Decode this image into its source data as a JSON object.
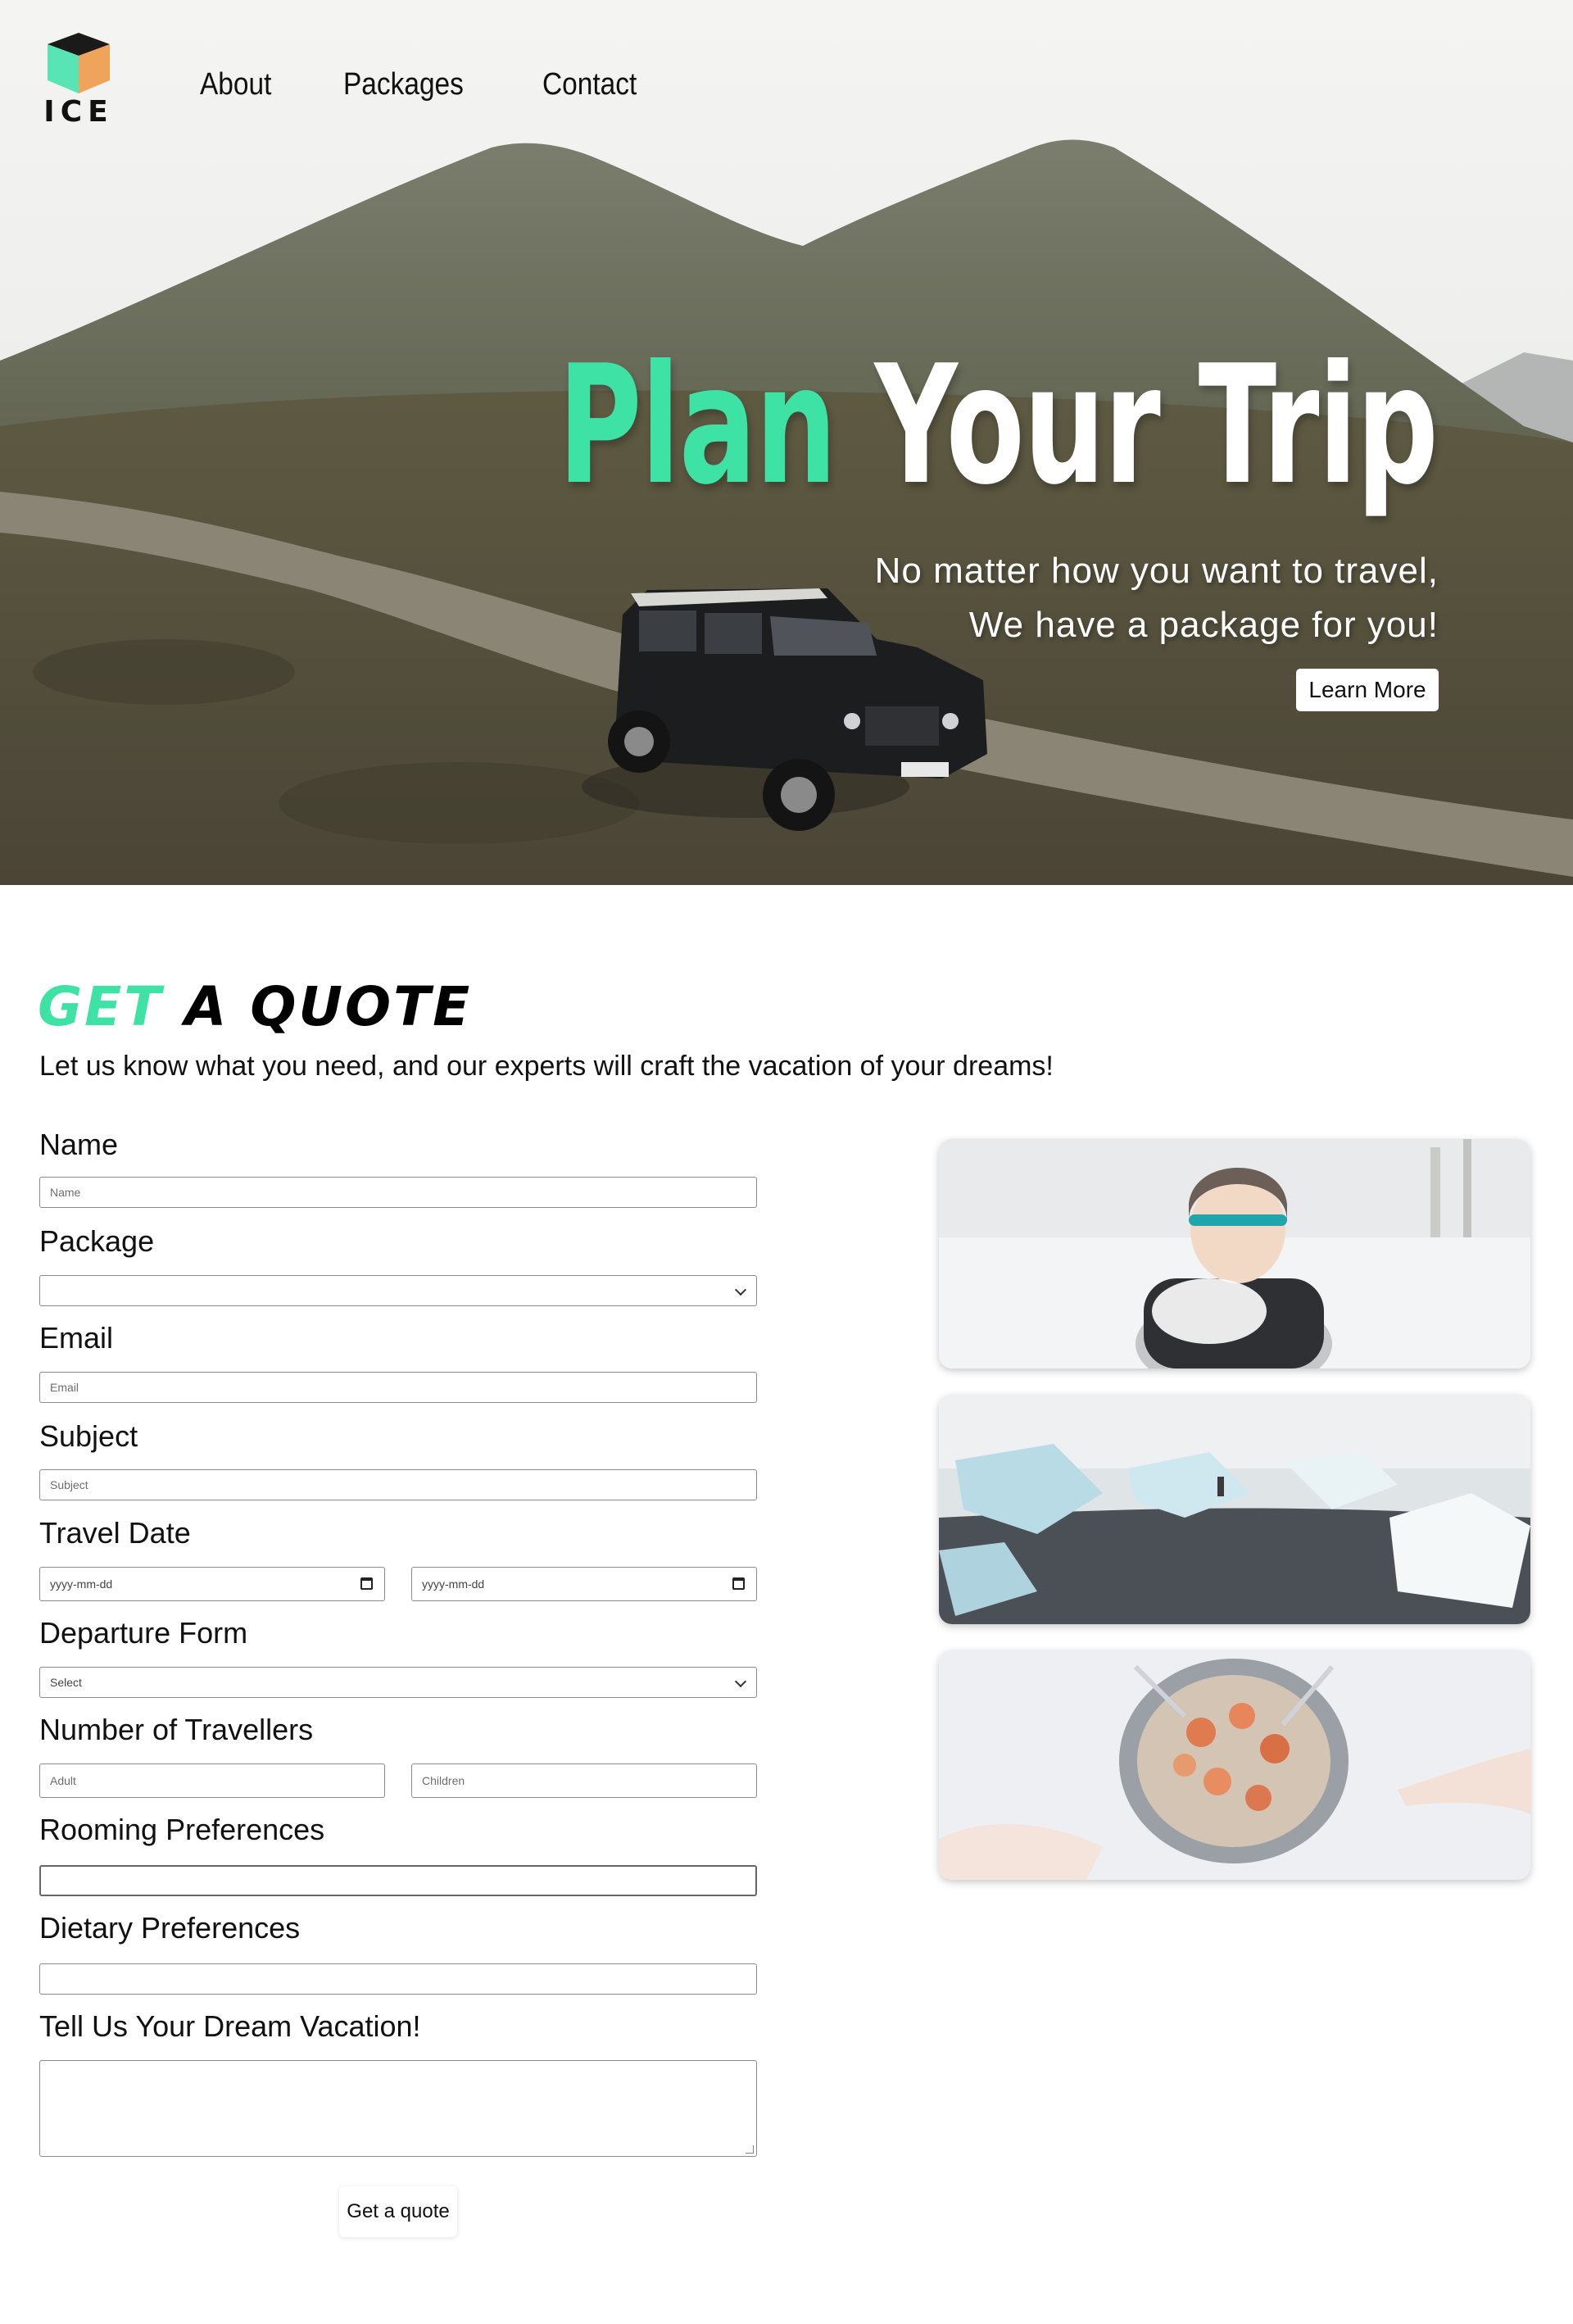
{
  "brand": {
    "logo_text": "ICE"
  },
  "nav": {
    "items": [
      "About",
      "Packages",
      "Contact"
    ]
  },
  "hero": {
    "title_accent": "Plan",
    "title_rest": "Your Trip",
    "subtitle_line1": "No matter how you want to travel,",
    "subtitle_line2": "We have a package for you!",
    "cta_label": "Learn More"
  },
  "quote": {
    "title_accent": "GET",
    "title_rest": "A QUOTE",
    "lead": "Let us know what you need, and our experts will craft the vacation of your dreams!",
    "submit_label": "Get a quote"
  },
  "form": {
    "name": {
      "label": "Name",
      "placeholder": "Name",
      "value": ""
    },
    "package": {
      "label": "Package",
      "selected": ""
    },
    "email": {
      "label": "Email",
      "placeholder": "Email",
      "value": ""
    },
    "subject": {
      "label": "Subject",
      "placeholder": "Subject",
      "value": ""
    },
    "travel_date": {
      "label": "Travel Date",
      "from_placeholder": "yyyy-mm-dd",
      "to_placeholder": "yyyy-mm-dd"
    },
    "departure": {
      "label": "Departure Form",
      "selected": "Select"
    },
    "travellers": {
      "label": "Number of Travellers",
      "adult_placeholder": "Adult",
      "children_placeholder": "Children"
    },
    "rooming": {
      "label": "Rooming Preferences",
      "value": ""
    },
    "dietary": {
      "label": "Dietary Preferences",
      "value": ""
    },
    "dream": {
      "label": "Tell Us Your Dream Vacation!",
      "value": ""
    }
  },
  "colors": {
    "accent": "#3ee2a4",
    "text": "#111111",
    "border": "#8b8b8b"
  },
  "icons": [
    "cube-logo-icon",
    "chevron-down-icon",
    "calendar-icon"
  ]
}
